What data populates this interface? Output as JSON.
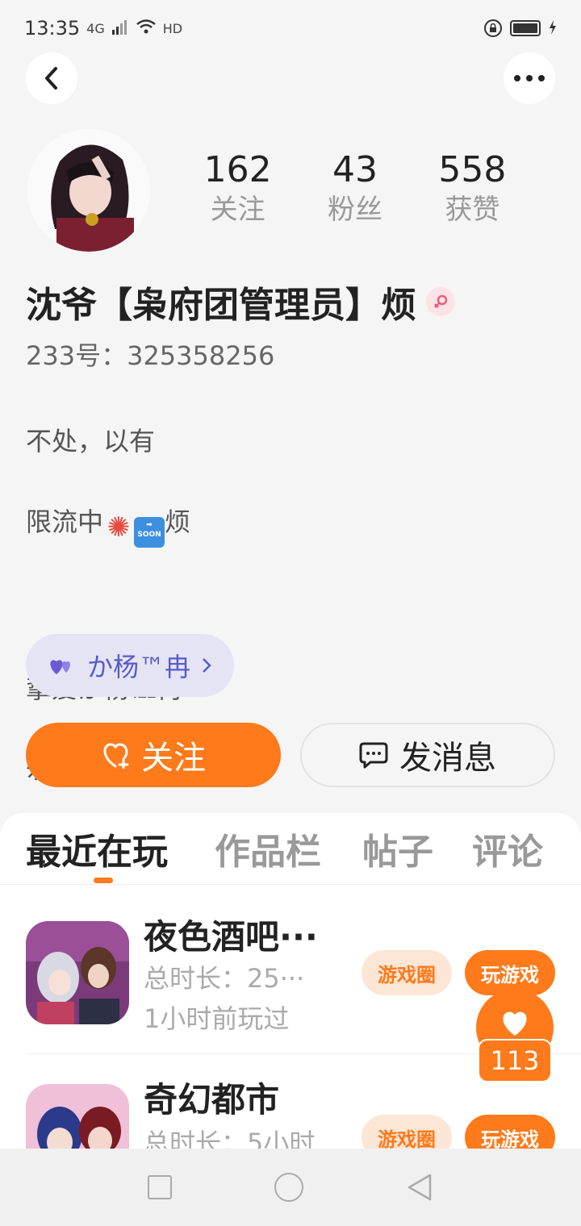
{
  "status_bar": {
    "time": "13:35",
    "network": "4G",
    "hd": "HD"
  },
  "profile": {
    "following_count": "162",
    "following_label": "关注",
    "followers_count": "43",
    "followers_label": "粉丝",
    "likes_count": "558",
    "likes_label": "获赞",
    "nickname": "沈爷【枭府团管理员】烦",
    "uid": "233号：325358256",
    "bio_line1": "不处，以有",
    "bio_line2_pre": "限流中",
    "bio_line2_post": "烦",
    "bio_line3": "挚爱か杨℡冉",
    "bio_line4": "勿动",
    "bio_line5": "设",
    "relation_tag": "か杨™冉"
  },
  "actions": {
    "follow_label": "关注",
    "message_label": "发消息"
  },
  "tabs": [
    {
      "label": "最近在玩"
    },
    {
      "label": "作品栏"
    },
    {
      "label": "帖子"
    },
    {
      "label": "评论"
    }
  ],
  "games": [
    {
      "title": "夜色酒吧···",
      "playtime": "总时长：25···",
      "last_played": "1小时前玩过",
      "circle_label": "游戏圈",
      "play_label": "玩游戏"
    },
    {
      "title": "奇幻都市",
      "playtime": "总时长：5小时",
      "circle_label": "游戏圈",
      "play_label": "玩游戏"
    }
  ],
  "like_fab": {
    "count": "113"
  },
  "colors": {
    "accent": "#ff7a1a",
    "relation_tag_bg": "#e4e4f5",
    "relation_tag_text": "#5a5ac8"
  }
}
